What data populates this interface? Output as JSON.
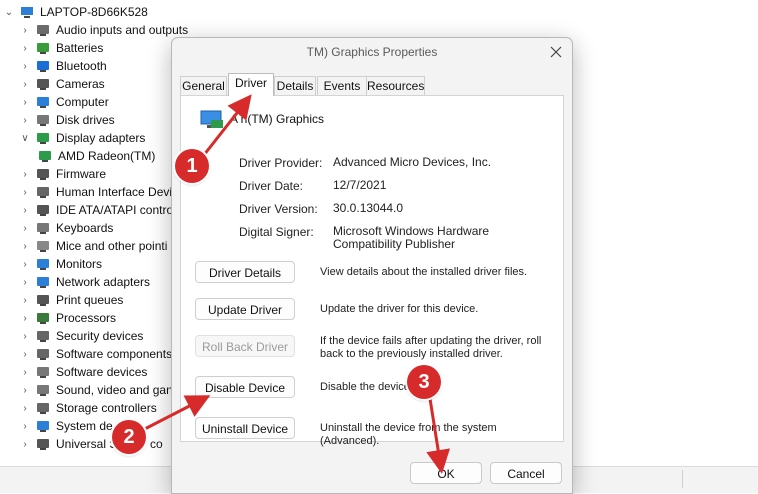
{
  "tree": {
    "root": "LAPTOP-8D66K528",
    "items": [
      {
        "label": "Audio inputs and outputs",
        "expanded": false,
        "icon": "speaker-icon"
      },
      {
        "label": "Batteries",
        "expanded": false,
        "icon": "battery-icon"
      },
      {
        "label": "Bluetooth",
        "expanded": false,
        "icon": "bluetooth-icon"
      },
      {
        "label": "Cameras",
        "expanded": false,
        "icon": "camera-icon"
      },
      {
        "label": "Computer",
        "expanded": false,
        "icon": "computer-icon"
      },
      {
        "label": "Disk drives",
        "expanded": false,
        "icon": "disk-icon"
      },
      {
        "label": "Display adapters",
        "expanded": true,
        "icon": "display-adapter-icon"
      },
      {
        "label": "AMD Radeon(TM)",
        "child": true,
        "icon": "display-adapter-icon"
      },
      {
        "label": "Firmware",
        "expanded": false,
        "icon": "firmware-icon"
      },
      {
        "label": "Human Interface Devi",
        "expanded": false,
        "icon": "hid-icon"
      },
      {
        "label": "IDE ATA/ATAPI contro",
        "expanded": false,
        "icon": "ide-icon"
      },
      {
        "label": "Keyboards",
        "expanded": false,
        "icon": "keyboard-icon"
      },
      {
        "label": "Mice and other pointi",
        "expanded": false,
        "icon": "mouse-icon"
      },
      {
        "label": "Monitors",
        "expanded": false,
        "icon": "monitor-icon"
      },
      {
        "label": "Network adapters",
        "expanded": false,
        "icon": "network-icon"
      },
      {
        "label": "Print queues",
        "expanded": false,
        "icon": "printer-icon"
      },
      {
        "label": "Processors",
        "expanded": false,
        "icon": "processor-icon"
      },
      {
        "label": "Security devices",
        "expanded": false,
        "icon": "security-icon"
      },
      {
        "label": "Software components",
        "expanded": false,
        "icon": "software-component-icon"
      },
      {
        "label": "Software devices",
        "expanded": false,
        "icon": "software-device-icon"
      },
      {
        "label": "Sound, video and gan",
        "expanded": false,
        "icon": "sound-icon"
      },
      {
        "label": "Storage controllers",
        "expanded": false,
        "icon": "storage-icon"
      },
      {
        "label": "System de",
        "expanded": false,
        "icon": "system-icon"
      },
      {
        "label": "Universal S",
        "expanded": false,
        "icon": "usb-icon"
      }
    ],
    "partial_labels": [
      "co"
    ]
  },
  "dialog": {
    "title": "TM) Graphics Properties",
    "tabs": [
      "General",
      "Driver",
      "Details",
      "Events",
      "Resources"
    ],
    "active_tab": "Driver",
    "device_name": "A          n(TM) Graphics",
    "props": [
      {
        "label": "Driver Provider:",
        "value": "Advanced Micro Devices, Inc."
      },
      {
        "label": "Driver Date:",
        "value": "12/7/2021"
      },
      {
        "label": "Driver Version:",
        "value": "30.0.13044.0"
      },
      {
        "label": "Digital Signer:",
        "value": "Microsoft Windows Hardware Compatibility Publisher"
      }
    ],
    "actions": [
      {
        "label": "Driver Details",
        "desc": "View details about the installed driver files.",
        "enabled": true
      },
      {
        "label": "Update Driver",
        "desc": "Update the driver for this device.",
        "enabled": true
      },
      {
        "label": "Roll Back Driver",
        "desc": "If the device fails after updating the driver, roll back to the previously installed driver.",
        "enabled": false
      },
      {
        "label": "Disable Device",
        "desc": "Disable the device.",
        "enabled": true
      },
      {
        "label": "Uninstall Device",
        "desc": "Uninstall the device from the system (Advanced).",
        "enabled": true
      }
    ],
    "ok_label": "OK",
    "cancel_label": "Cancel"
  },
  "annotations": {
    "badges": [
      "1",
      "2",
      "3"
    ],
    "color": "#d72b2b"
  }
}
